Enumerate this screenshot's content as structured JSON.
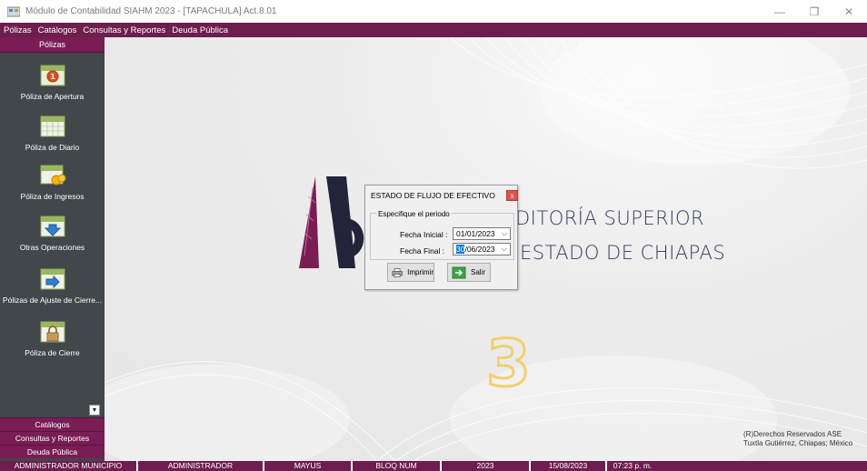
{
  "window": {
    "title": "Módulo de Contabilidad SIAHM 2023 - [TAPACHULA] Act.8.01",
    "minimize_glyph": "—",
    "restore_glyph": "❐",
    "close_glyph": "✕"
  },
  "menubar": {
    "items": [
      "Pólizas",
      "Catálogos",
      "Consultas y Reportes",
      "Deuda Pública"
    ]
  },
  "sidebar": {
    "header": "Pólizas",
    "items": [
      {
        "label": "Póliza de Apertura",
        "icon": "calendar-one-icon"
      },
      {
        "label": "Póliza de Diario",
        "icon": "calendar-icon"
      },
      {
        "label": "Póliza de Ingresos",
        "icon": "calendar-coins-icon"
      },
      {
        "label": "Otras Operaciones",
        "icon": "calendar-arrow-icon"
      },
      {
        "label": "Pólizas de Ajuste de Cierre...",
        "icon": "calendar-adjust-icon"
      },
      {
        "label": "Póliza de Cierre",
        "icon": "calendar-lock-icon"
      }
    ],
    "bottom_sections": [
      "Catálogos",
      "Consultas y Reportes",
      "Deuda Pública"
    ]
  },
  "background": {
    "logo_line1": "DITORÍA SUPERIOR",
    "logo_line2": "ESTADO DE CHIAPAS",
    "big_digit": "3",
    "rights_line1": "(R)Derechos Reservados ASE",
    "rights_line2": "Tuxtla Gutiérrez, Chiapas; México"
  },
  "dialog": {
    "title": "ESTADO DE FLUJO DE EFECTIVO",
    "close_label": "x",
    "group_label": "Especifique el periodo",
    "fecha_inicial_label": "Fecha Inicial :",
    "fecha_inicial_value": "01/01/2023",
    "fecha_final_label": "Fecha Final :",
    "fecha_final_day": "30",
    "fecha_final_rest": "/06/2023",
    "print_label": "Imprimir",
    "exit_label": "Salir"
  },
  "statusbar": {
    "items": [
      "ADMINISTRADOR MUNICIPIO",
      "ADMINISTRADOR",
      "MAYUS",
      "BLOQ NUM",
      "2023",
      "15/08/2023",
      "07:23 p. m."
    ]
  },
  "colors": {
    "brand": "#6e1d4f",
    "sidebar_bg": "#41474a",
    "logo_text": "#333a5a",
    "digit_outline": "#f4d06b"
  }
}
